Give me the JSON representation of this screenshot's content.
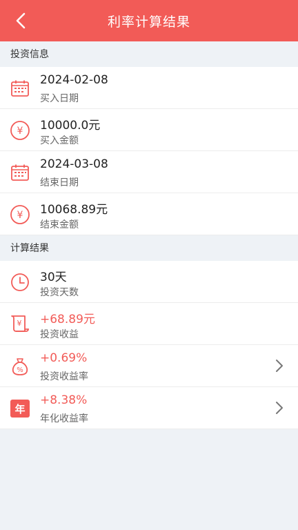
{
  "header": {
    "title": "利率计算结果"
  },
  "sections": {
    "invest": {
      "title": "投资信息"
    },
    "result": {
      "title": "计算结果"
    }
  },
  "invest_rows": [
    {
      "value": "2024-02-08",
      "label": "买入日期",
      "icon": "calendar-icon"
    },
    {
      "value": "10000.0元",
      "label": "买入金额",
      "icon": "yen-icon"
    },
    {
      "value": "2024-03-08",
      "label": "结束日期",
      "icon": "calendar-icon"
    },
    {
      "value": "10068.89元",
      "label": "结束金额",
      "icon": "yen-icon"
    }
  ],
  "result_rows": [
    {
      "value": "30天",
      "label": "投资天数",
      "icon": "clock-icon"
    },
    {
      "value": "+68.89元",
      "label": "投资收益",
      "icon": "yen-scroll-icon"
    },
    {
      "value": "+0.69%",
      "label": "投资收益率",
      "icon": "percent-bag-icon"
    },
    {
      "value": "+8.38%",
      "label": "年化收益率",
      "icon": "nian-icon",
      "icon_text": "年"
    }
  ],
  "colors": {
    "accent": "#f25b57",
    "background": "#eef2f6"
  }
}
